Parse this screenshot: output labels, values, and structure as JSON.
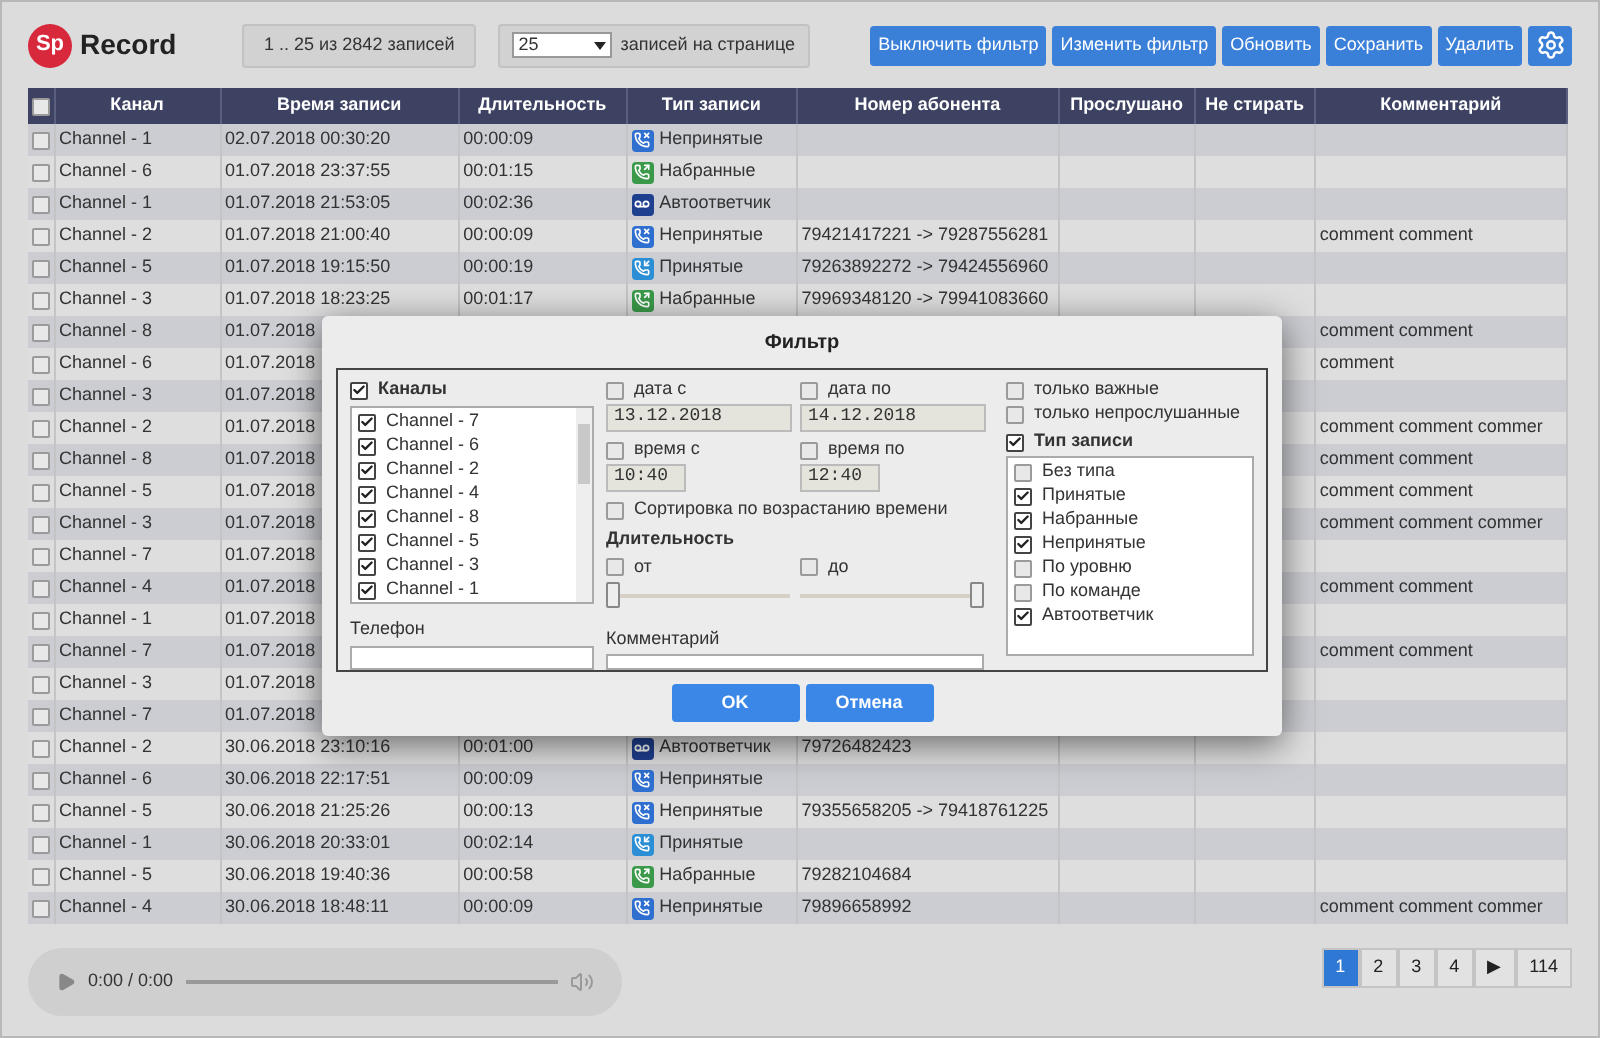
{
  "logo": {
    "badge": "Sp",
    "text": "Record"
  },
  "records_info": "1 .. 25 из 2842 записей",
  "page_size": {
    "value": "25",
    "label": "записей на странице"
  },
  "toolbar_buttons": [
    "Выключить фильтр",
    "Изменить фильтр",
    "Обновить",
    "Сохранить",
    "Удалить"
  ],
  "table": {
    "select_all": {
      "checked": false
    },
    "columns": [
      "Канал",
      "Время записи",
      "Длительность",
      "Тип записи",
      "Номер абонента",
      "Прослушано",
      "Не стирать",
      "Комментарий"
    ],
    "rows": [
      {
        "checked": false,
        "channel": "Channel - 1",
        "time": "02.07.2018 00:30:20",
        "duration": "00:00:09",
        "type": {
          "kind": "missed",
          "label": "Непринятые"
        }
      },
      {
        "checked": false,
        "channel": "Channel - 6",
        "time": "01.07.2018 23:37:55",
        "duration": "00:01:15",
        "type": {
          "kind": "outgoing",
          "label": "Набранные"
        }
      },
      {
        "checked": false,
        "channel": "Channel - 1",
        "time": "01.07.2018 21:53:05",
        "duration": "00:02:36",
        "type": {
          "kind": "voicemail",
          "label": "Автоответчик"
        }
      },
      {
        "checked": false,
        "channel": "Channel - 2",
        "time": "01.07.2018 21:00:40",
        "duration": "00:00:09",
        "type": {
          "kind": "missed",
          "label": "Непринятые"
        },
        "number": "79421417221 -> 79287556281",
        "comment": "comment comment"
      },
      {
        "checked": false,
        "channel": "Channel - 5",
        "time": "01.07.2018 19:15:50",
        "duration": "00:00:19",
        "type": {
          "kind": "incoming",
          "label": "Принятые"
        },
        "number": "79263892272 -> 79424556960"
      },
      {
        "checked": false,
        "channel": "Channel - 3",
        "time": "01.07.2018 18:23:25",
        "duration": "00:01:17",
        "type": {
          "kind": "outgoing",
          "label": "Набранные"
        },
        "number": "79969348120 -> 79941083660"
      },
      {
        "checked": false,
        "channel": "Channel - 8",
        "time": "01.07.2018",
        "comment": "comment comment"
      },
      {
        "checked": false,
        "channel": "Channel - 6",
        "time": "01.07.2018",
        "comment": "comment"
      },
      {
        "checked": false,
        "channel": "Channel - 3",
        "time": "01.07.2018"
      },
      {
        "checked": false,
        "channel": "Channel - 2",
        "time": "01.07.2018",
        "comment": "comment comment commer"
      },
      {
        "checked": false,
        "channel": "Channel - 8",
        "time": "01.07.2018",
        "comment": "comment comment"
      },
      {
        "checked": false,
        "channel": "Channel - 5",
        "time": "01.07.2018",
        "comment": "comment comment"
      },
      {
        "checked": false,
        "channel": "Channel - 3",
        "time": "01.07.2018",
        "comment": "comment comment commer"
      },
      {
        "checked": false,
        "channel": "Channel - 7",
        "time": "01.07.2018"
      },
      {
        "checked": false,
        "channel": "Channel - 4",
        "time": "01.07.2018",
        "comment": "comment comment"
      },
      {
        "checked": false,
        "channel": "Channel - 1",
        "time": "01.07.2018"
      },
      {
        "checked": false,
        "channel": "Channel - 7",
        "time": "01.07.2018",
        "comment": "comment comment"
      },
      {
        "checked": false,
        "channel": "Channel - 3",
        "time": "01.07.2018"
      },
      {
        "checked": false,
        "channel": "Channel - 7",
        "time": "01.07.2018"
      },
      {
        "checked": false,
        "channel": "Channel - 2",
        "time": "30.06.2018 23:10:16",
        "duration": "00:01:00",
        "type": {
          "kind": "voicemail",
          "label": "Автоответчик"
        },
        "number": "79726482423"
      },
      {
        "checked": false,
        "channel": "Channel - 6",
        "time": "30.06.2018 22:17:51",
        "duration": "00:00:09",
        "type": {
          "kind": "missed",
          "label": "Непринятые"
        }
      },
      {
        "checked": false,
        "channel": "Channel - 5",
        "time": "30.06.2018 21:25:26",
        "duration": "00:00:13",
        "type": {
          "kind": "missed",
          "label": "Непринятые"
        },
        "number": "79355658205 -> 79418761225"
      },
      {
        "checked": false,
        "channel": "Channel - 1",
        "time": "30.06.2018 20:33:01",
        "duration": "00:02:14",
        "type": {
          "kind": "incoming",
          "label": "Принятые"
        }
      },
      {
        "checked": false,
        "channel": "Channel - 5",
        "time": "30.06.2018 19:40:36",
        "duration": "00:00:58",
        "type": {
          "kind": "outgoing",
          "label": "Набранные"
        },
        "number": "79282104684"
      },
      {
        "checked": false,
        "channel": "Channel - 4",
        "time": "30.06.2018 18:48:11",
        "duration": "00:00:09",
        "type": {
          "kind": "missed",
          "label": "Непринятые"
        },
        "number": "79896658992",
        "comment": "comment comment commer"
      }
    ]
  },
  "filter_dialog": {
    "title": "Фильтр",
    "channels": {
      "label": "Каналы",
      "checked": true,
      "items": [
        {
          "label": "Channel - 7",
          "checked": true
        },
        {
          "label": "Channel - 6",
          "checked": true
        },
        {
          "label": "Channel - 2",
          "checked": true
        },
        {
          "label": "Channel - 4",
          "checked": true
        },
        {
          "label": "Channel - 8",
          "checked": true
        },
        {
          "label": "Channel - 5",
          "checked": true
        },
        {
          "label": "Channel - 3",
          "checked": true
        },
        {
          "label": "Channel - 1",
          "checked": true
        }
      ]
    },
    "phone": {
      "label": "Телефон"
    },
    "date_from": {
      "label": "дата с",
      "checked": false,
      "value": "13.12.2018"
    },
    "date_to": {
      "label": "дата по",
      "checked": false,
      "value": "14.12.2018"
    },
    "time_from": {
      "label": "время с",
      "checked": false,
      "value": "10:40"
    },
    "time_to": {
      "label": "время по",
      "checked": false,
      "value": "12:40"
    },
    "sort_ascending": {
      "label": "Сортировка по возрастанию времени",
      "checked": false
    },
    "duration": {
      "label": "Длительность",
      "from": {
        "label": "от",
        "checked": false,
        "level": 0
      },
      "to": {
        "label": "до",
        "checked": false,
        "level": 1
      }
    },
    "comment": {
      "label": "Комментарий"
    },
    "only_important": {
      "label": "только важные",
      "checked": false
    },
    "only_unheard": {
      "label": "только непрослушанные",
      "checked": false
    },
    "record_types": {
      "label": "Тип записи",
      "checked": true,
      "items": [
        {
          "label": "Без типа",
          "checked": false
        },
        {
          "label": "Принятые",
          "checked": true
        },
        {
          "label": "Набранные",
          "checked": true
        },
        {
          "label": "Непринятые",
          "checked": true
        },
        {
          "label": "По уровню",
          "checked": false
        },
        {
          "label": "По команде",
          "checked": false
        },
        {
          "label": "Автоответчик",
          "checked": true
        }
      ]
    },
    "buttons": [
      "OK",
      "Отмена"
    ]
  },
  "player": {
    "time": "0:00 / 0:00",
    "level": 0
  },
  "pagination": [
    {
      "label": "1",
      "selected": true
    },
    {
      "label": "2",
      "selected": false
    },
    {
      "label": "3",
      "selected": false
    },
    {
      "label": "4",
      "selected": false
    },
    {
      "label": "▶",
      "selected": false
    },
    {
      "label": "114",
      "selected": false
    }
  ]
}
